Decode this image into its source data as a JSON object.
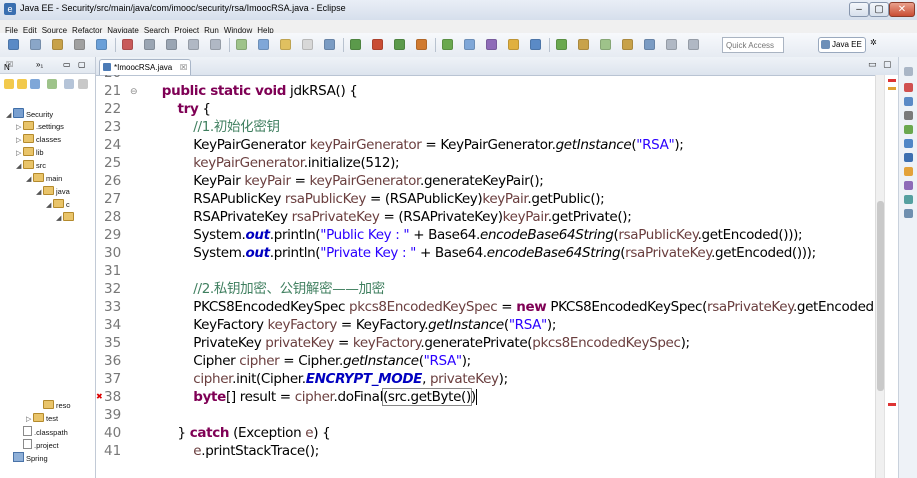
{
  "window": {
    "title": "Java EE - Security/src/main/java/com/imooc/security/rsa/ImoocRSA.java - Eclipse",
    "controls": {
      "minimize": "–",
      "maximize": "▢",
      "close": "✕"
    }
  },
  "menu": [
    "File",
    "Edit",
    "Source",
    "Refactor",
    "Navigate",
    "Search",
    "Project",
    "Run",
    "Window",
    "Help"
  ],
  "toolbar": {
    "quick_access_placeholder": "Quick Access",
    "perspective_javaee": "Java EE",
    "perspective_debug_icon": "debug-perspective-icon"
  },
  "package_explorer": {
    "tab_label": "N",
    "tab_symbol": "☒",
    "hierarchy_label": "»₁",
    "tree": [
      {
        "label": "Security",
        "icon": "project",
        "depth": 0,
        "twisty": "◢"
      },
      {
        "label": ".settings",
        "icon": "folder",
        "depth": 1,
        "twisty": "▷"
      },
      {
        "label": "classes",
        "icon": "folder",
        "depth": 1,
        "twisty": "▷"
      },
      {
        "label": "lib",
        "icon": "folder",
        "depth": 1,
        "twisty": "▷"
      },
      {
        "label": "src",
        "icon": "folder",
        "depth": 1,
        "twisty": "◢"
      },
      {
        "label": "main",
        "icon": "folder",
        "depth": 2,
        "twisty": "◢"
      },
      {
        "label": "java",
        "icon": "folder",
        "depth": 3,
        "twisty": "◢"
      },
      {
        "label": "c",
        "icon": "folder",
        "depth": 4,
        "twisty": "◢"
      },
      {
        "label": "",
        "icon": "folder",
        "depth": 5,
        "twisty": "◢"
      },
      {
        "label": "reso",
        "icon": "folder",
        "depth": 3,
        "twisty": ""
      },
      {
        "label": "test",
        "icon": "folder",
        "depth": 2,
        "twisty": "▷"
      },
      {
        "label": ".classpath",
        "icon": "file",
        "depth": 1,
        "twisty": ""
      },
      {
        "label": ".project",
        "icon": "file",
        "depth": 1,
        "twisty": ""
      },
      {
        "label": "Spring",
        "icon": "library",
        "depth": 0,
        "twisty": ""
      }
    ]
  },
  "editor": {
    "tab_label": "*ImoocRSA.java",
    "tab_close": "☒",
    "lines": [
      {
        "num": "20",
        "tokens": []
      },
      {
        "num": "21",
        "fold": "⊖",
        "tokens": [
          [
            "    ",
            "plain"
          ],
          [
            "public static void",
            "kw"
          ],
          [
            " jdkRSA() {",
            "plain"
          ]
        ]
      },
      {
        "num": "22",
        "tokens": [
          [
            "        ",
            "plain"
          ],
          [
            "try",
            "kw"
          ],
          [
            " {",
            "plain"
          ]
        ]
      },
      {
        "num": "23",
        "tokens": [
          [
            "            ",
            "plain"
          ],
          [
            "//1.初始化密钥",
            "cmt"
          ]
        ]
      },
      {
        "num": "24",
        "tokens": [
          [
            "            KeyPairGenerator ",
            "plain"
          ],
          [
            "keyPairGenerator",
            "var"
          ],
          [
            " = KeyPairGenerator.",
            "plain"
          ],
          [
            "getInstance",
            "static"
          ],
          [
            "(",
            "plain"
          ],
          [
            "\"RSA\"",
            "str"
          ],
          [
            ");",
            "plain"
          ]
        ]
      },
      {
        "num": "25",
        "tokens": [
          [
            "            ",
            "plain"
          ],
          [
            "keyPairGenerator",
            "var"
          ],
          [
            ".initialize(512);",
            "plain"
          ]
        ]
      },
      {
        "num": "26",
        "tokens": [
          [
            "            KeyPair ",
            "plain"
          ],
          [
            "keyPair",
            "var"
          ],
          [
            " = ",
            "plain"
          ],
          [
            "keyPairGenerator",
            "var"
          ],
          [
            ".generateKeyPair();",
            "plain"
          ]
        ]
      },
      {
        "num": "27",
        "tokens": [
          [
            "            RSAPublicKey ",
            "plain"
          ],
          [
            "rsaPublicKey",
            "var"
          ],
          [
            " = (RSAPublicKey)",
            "plain"
          ],
          [
            "keyPair",
            "var"
          ],
          [
            ".getPublic();",
            "plain"
          ]
        ]
      },
      {
        "num": "28",
        "tokens": [
          [
            "            RSAPrivateKey ",
            "plain"
          ],
          [
            "rsaPrivateKey",
            "var"
          ],
          [
            " = (RSAPrivateKey)",
            "plain"
          ],
          [
            "keyPair",
            "var"
          ],
          [
            ".getPrivate();",
            "plain"
          ]
        ]
      },
      {
        "num": "29",
        "tokens": [
          [
            "            System.",
            "plain"
          ],
          [
            "out",
            "field"
          ],
          [
            ".println(",
            "plain"
          ],
          [
            "\"Public Key : \"",
            "str"
          ],
          [
            " + Base64.",
            "plain"
          ],
          [
            "encodeBase64String",
            "static"
          ],
          [
            "(",
            "plain"
          ],
          [
            "rsaPublicKey",
            "var"
          ],
          [
            ".getEncoded()));",
            "plain"
          ]
        ]
      },
      {
        "num": "30",
        "tokens": [
          [
            "            System.",
            "plain"
          ],
          [
            "out",
            "field"
          ],
          [
            ".println(",
            "plain"
          ],
          [
            "\"Private Key : \"",
            "str"
          ],
          [
            " + Base64.",
            "plain"
          ],
          [
            "encodeBase64String",
            "static"
          ],
          [
            "(",
            "plain"
          ],
          [
            "rsaPrivateKey",
            "var"
          ],
          [
            ".getEncoded()));",
            "plain"
          ]
        ]
      },
      {
        "num": "31",
        "tokens": []
      },
      {
        "num": "32",
        "tokens": [
          [
            "            ",
            "plain"
          ],
          [
            "//2.私钥加密、公钥解密——加密",
            "cmt"
          ]
        ]
      },
      {
        "num": "33",
        "tokens": [
          [
            "            PKCS8EncodedKeySpec ",
            "plain"
          ],
          [
            "pkcs8EncodedKeySpec",
            "var"
          ],
          [
            " = ",
            "plain"
          ],
          [
            "new",
            "kw"
          ],
          [
            " PKCS8EncodedKeySpec(",
            "plain"
          ],
          [
            "rsaPrivateKey",
            "var"
          ],
          [
            ".getEncoded",
            "plain"
          ]
        ]
      },
      {
        "num": "34",
        "tokens": [
          [
            "            KeyFactory ",
            "plain"
          ],
          [
            "keyFactory",
            "var"
          ],
          [
            " = KeyFactory.",
            "plain"
          ],
          [
            "getInstance",
            "static"
          ],
          [
            "(",
            "plain"
          ],
          [
            "\"RSA\"",
            "str"
          ],
          [
            ");",
            "plain"
          ]
        ]
      },
      {
        "num": "35",
        "tokens": [
          [
            "            PrivateKey ",
            "plain"
          ],
          [
            "privateKey",
            "var"
          ],
          [
            " = ",
            "plain"
          ],
          [
            "keyFactory",
            "var"
          ],
          [
            ".generatePrivate(",
            "plain"
          ],
          [
            "pkcs8EncodedKeySpec",
            "var"
          ],
          [
            ");",
            "plain"
          ]
        ]
      },
      {
        "num": "36",
        "tokens": [
          [
            "            Cipher ",
            "plain"
          ],
          [
            "cipher",
            "var"
          ],
          [
            " = Cipher.",
            "plain"
          ],
          [
            "getInstance",
            "static"
          ],
          [
            "(",
            "plain"
          ],
          [
            "\"RSA\"",
            "str"
          ],
          [
            ");",
            "plain"
          ]
        ]
      },
      {
        "num": "37",
        "tokens": [
          [
            "            ",
            "plain"
          ],
          [
            "cipher",
            "var"
          ],
          [
            ".init(Cipher.",
            "plain"
          ],
          [
            "ENCRYPT_MODE",
            "field"
          ],
          [
            ", ",
            "plain"
          ],
          [
            "privateKey",
            "var"
          ],
          [
            ");",
            "plain"
          ]
        ]
      },
      {
        "num": "38",
        "marker": "error",
        "tokens": [
          [
            "            ",
            "plain"
          ],
          [
            "byte",
            "kw"
          ],
          [
            "[] result = ",
            "plain"
          ],
          [
            "cipher",
            "var"
          ],
          [
            ".doFinal",
            "plain"
          ],
          [
            "(src.getByte()",
            "box"
          ],
          [
            ")",
            "plain"
          ]
        ]
      },
      {
        "num": "39",
        "tokens": []
      },
      {
        "num": "40",
        "tokens": [
          [
            "        } ",
            "plain"
          ],
          [
            "catch",
            "kw"
          ],
          [
            " (Exception ",
            "plain"
          ],
          [
            "e",
            "var"
          ],
          [
            ") {",
            "plain"
          ]
        ]
      },
      {
        "num": "41",
        "tokens": [
          [
            "            ",
            "plain"
          ],
          [
            "e",
            "var"
          ],
          [
            ".printStackTrace();",
            "plain"
          ]
        ]
      }
    ]
  }
}
